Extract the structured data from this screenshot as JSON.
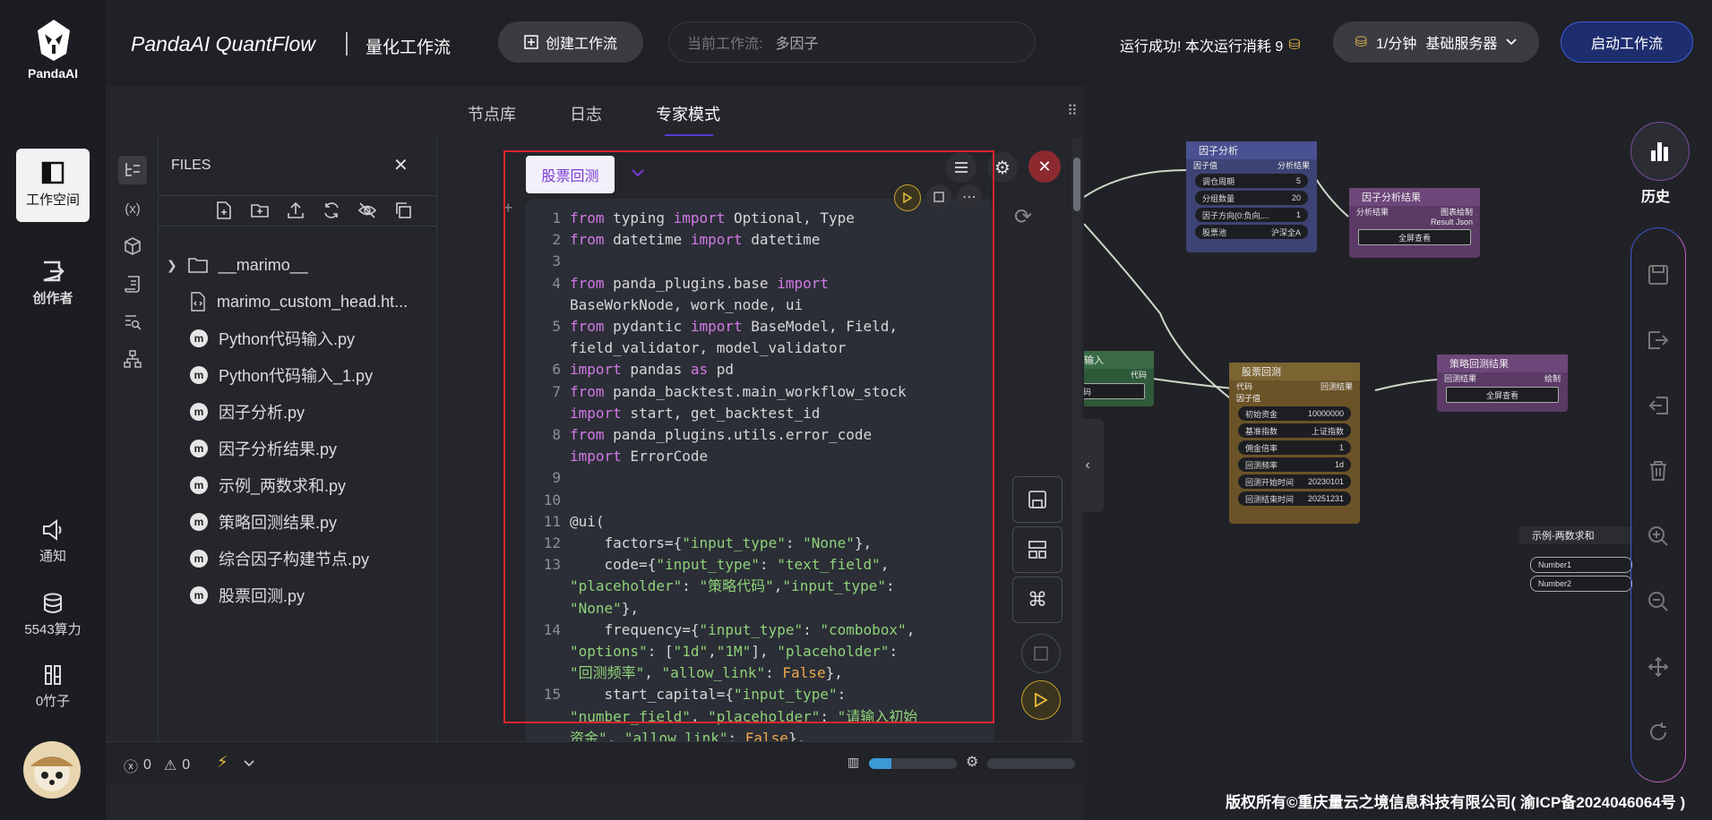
{
  "app": {
    "logo_text": "PandaAI",
    "title": "PandaAI QuantFlow",
    "subtitle": "量化工作流",
    "create_button": "创建工作流",
    "current_label": "当前工作流:",
    "current_value": "多因子",
    "status_text": "运行成功!  本次运行消耗 9",
    "server_rate": "1/分钟",
    "server_name": "基础服务器",
    "start_button": "启动工作流"
  },
  "sidebar": {
    "workspace": "工作空间",
    "creator": "创作者",
    "notify": "通知",
    "compute": "5543算力",
    "bamboo": "0竹子"
  },
  "tabs": [
    "节点库",
    "日志",
    "专家模式"
  ],
  "files": {
    "header": "FILES",
    "items": [
      {
        "name": "__marimo__",
        "type": "folder"
      },
      {
        "name": "marimo_custom_head.ht...",
        "type": "html"
      },
      {
        "name": "Python代码输入.py",
        "type": "py"
      },
      {
        "name": "Python代码输入_1.py",
        "type": "py"
      },
      {
        "name": "因子分析.py",
        "type": "py"
      },
      {
        "name": "因子分析结果.py",
        "type": "py"
      },
      {
        "name": "示例_两数求和.py",
        "type": "py"
      },
      {
        "name": "策略回测结果.py",
        "type": "py"
      },
      {
        "name": "综合因子构建节点.py",
        "type": "py"
      },
      {
        "name": "股票回测.py",
        "type": "py"
      }
    ]
  },
  "editor": {
    "selected_file": "股票回测",
    "lines": [
      {
        "n": "1",
        "h": "<span class='kw'>from</span> typing <span class='kw'>import</span> Optional, Type"
      },
      {
        "n": "2",
        "h": "<span class='kw'>from</span> datetime <span class='kw'>import</span> datetime"
      },
      {
        "n": "3",
        "h": ""
      },
      {
        "n": "4",
        "h": "<span class='kw'>from</span> panda_plugins.base <span class='kw'>import</span>\nBaseWorkNode, work_node, ui"
      },
      {
        "n": "5",
        "h": "<span class='kw'>from</span> pydantic <span class='kw'>import</span> BaseModel, Field,\nfield_validator, model_validator"
      },
      {
        "n": "6",
        "h": "<span class='kw'>import</span> pandas <span class='kw'>as</span> pd"
      },
      {
        "n": "7",
        "h": "<span class='kw'>from</span> panda_backtest.main_workflow_stock\n<span class='kw'>import</span> start, get_backtest_id"
      },
      {
        "n": "8",
        "h": "<span class='kw'>from</span> panda_plugins.utils.error_code\n<span class='kw'>import</span> ErrorCode"
      },
      {
        "n": "9",
        "h": ""
      },
      {
        "n": "10",
        "h": ""
      },
      {
        "n": "11",
        "h": "@ui("
      },
      {
        "n": "12",
        "h": "    factors={<span class='str'>\"input_type\"</span>: <span class='str'>\"None\"</span>},"
      },
      {
        "n": "13",
        "h": "    code={<span class='str'>\"input_type\"</span>: <span class='str'>\"text_field\"</span>,\n<span class='str'>\"placeholder\"</span>: <span class='str'>\"策略代码\"</span>,<span class='str'>\"input_type\"</span>:\n<span class='str'>\"None\"</span>},"
      },
      {
        "n": "14",
        "h": "    frequency={<span class='str'>\"input_type\"</span>: <span class='str'>\"combobox\"</span>,\n<span class='str'>\"options\"</span>: [<span class='str'>\"1d\"</span>,<span class='str'>\"1M\"</span>], <span class='str'>\"placeholder\"</span>:\n<span class='str'>\"回测频率\"</span>, <span class='str'>\"allow_link\"</span>: <span class='num'>False</span>},"
      },
      {
        "n": "15",
        "h": "    start_capital={<span class='str'>\"input_type\"</span>:\n<span class='str'>\"number_field\"</span>, <span class='str'>\"placeholder\"</span>: <span class='str'>\"请输入初始\n资金\"</span>, <span class='str'>\"allow_link\"</span>: <span class='num'>False</span>},"
      }
    ]
  },
  "statusbar": {
    "errors": "0",
    "warnings": "0"
  },
  "nodes": {
    "factor_analysis": {
      "title": "因子分析",
      "in": "因子值",
      "out": "分析结果",
      "f1": "调仓周期",
      "v1": "5",
      "f2": "分组数量",
      "v2": "20",
      "f3": "因子方向(0:负向,...",
      "v3": "1",
      "f4": "股票池",
      "v4": "沪深全A"
    },
    "factor_result": {
      "title": "因子分析结果",
      "in": "分析结果",
      "out": "图表绘制",
      "out2": "Result Json",
      "btn": "全屏查看"
    },
    "code_input": {
      "title": "输入",
      "out": "代码",
      "field": "码"
    },
    "backtest": {
      "title": "股票回测",
      "in1": "代码",
      "in2": "因子值",
      "out": "回测结果",
      "f1": "初始资金",
      "v1": "10000000",
      "f2": "基准指数",
      "v2": "上证指数",
      "f3": "佣金倍率",
      "v3": "1",
      "f4": "回测频率",
      "v4": "1d",
      "f5": "回测开始时间",
      "v5": "20230101",
      "f6": "回测结束时间",
      "v6": "20251231"
    },
    "strategy_result": {
      "title": "策略回测结果",
      "in": "回测结果",
      "out": "绘制",
      "btn": "全屏查看"
    },
    "sum": {
      "title": "示例-两数求和",
      "f1": "Number1",
      "f2": "Number2"
    }
  },
  "history_label": "历史",
  "copyright": "版权所有©重庆量云之境信息科技有限公司( 渝ICP备2024046064号 )"
}
